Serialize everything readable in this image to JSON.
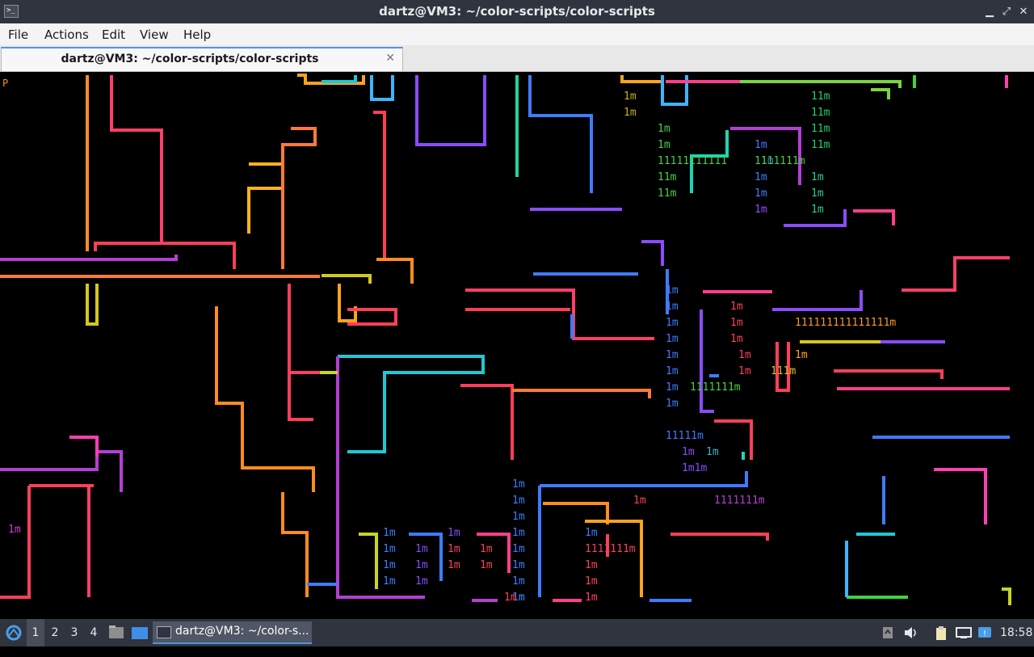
{
  "window": {
    "title": "dartz@VM3: ~/color-scripts/color-scripts",
    "minimize_glyph": "▁",
    "maximize_glyph": "⤢",
    "close_glyph": "✕"
  },
  "menu": {
    "file": "File",
    "actions": "Actions",
    "edit": "Edit",
    "view": "View",
    "help": "Help"
  },
  "tab": {
    "label": "dartz@VM3: ~/color-scripts/color-scripts",
    "close_glyph": "✕"
  },
  "terminal": {
    "prompt_fragment": "P",
    "glyph_groups": [
      {
        "text": "1m",
        "color": "#c8b400"
      },
      {
        "text": "1m",
        "color": "#c8b400"
      },
      {
        "text": "11m",
        "color": "#1fd06a"
      },
      {
        "text": "11m",
        "color": "#1fd06a"
      },
      {
        "text": "11m",
        "color": "#1fd06a"
      },
      {
        "text": "11m",
        "color": "#1fd06a"
      },
      {
        "text": "1m",
        "color": "#3fd43f"
      },
      {
        "text": "1m",
        "color": "#3fd43f"
      },
      {
        "text": "11111111111",
        "color": "#3fd43f"
      },
      {
        "text": "11m",
        "color": "#3fd43f"
      },
      {
        "text": "11m",
        "color": "#3fd43f"
      },
      {
        "text": "1m",
        "color": "#3f7bff"
      },
      {
        "text": "1111111m",
        "color": "#3fd43f"
      },
      {
        "text": "1m",
        "color": "#2ccf8a"
      },
      {
        "text": "1m",
        "color": "#2ccf8a"
      },
      {
        "text": "1m",
        "color": "#2ccf8a"
      },
      {
        "text": "1m",
        "color": "#3f7bff"
      },
      {
        "text": "1m",
        "color": "#3f7bff"
      },
      {
        "text": "1m",
        "color": "#3f7bff"
      },
      {
        "text": "1m",
        "color": "#8a4cff"
      },
      {
        "text": "1m",
        "color": "#3f7bff"
      },
      {
        "text": "1m",
        "color": "#3f7bff"
      },
      {
        "text": "1m",
        "color": "#3f7bff"
      },
      {
        "text": "1m",
        "color": "#3f7bff"
      },
      {
        "text": "1m",
        "color": "#3f7bff"
      },
      {
        "text": "1m",
        "color": "#3f7bff"
      },
      {
        "text": "1m",
        "color": "#3f7bff"
      },
      {
        "text": "1m",
        "color": "#3f7bff"
      },
      {
        "text": "11111m",
        "color": "#3f7bff"
      },
      {
        "text": "1m",
        "color": "#8a4cff"
      },
      {
        "text": "1m",
        "color": "#3fb4c8"
      },
      {
        "text": "1m1m",
        "color": "#8a4cff"
      },
      {
        "text": "1m",
        "color": "#ff3f5a"
      },
      {
        "text": "1m",
        "color": "#ff3f5a"
      },
      {
        "text": "1m",
        "color": "#ff3f5a"
      },
      {
        "text": "1m",
        "color": "#ff3f5a"
      },
      {
        "text": "1m",
        "color": "#ff3f5a"
      },
      {
        "text": "1111111m",
        "color": "#3fd43f"
      },
      {
        "text": "111111111111111m",
        "color": "#ff9a1f"
      },
      {
        "text": "1m",
        "color": "#ffa71f"
      },
      {
        "text": "111m",
        "color": "#d4c81f"
      },
      {
        "text": "1m",
        "color": "#3f7bff"
      },
      {
        "text": "1m",
        "color": "#3f7bff"
      },
      {
        "text": "1m",
        "color": "#3f7bff"
      },
      {
        "text": "1m",
        "color": "#3f7bff"
      },
      {
        "text": "1m",
        "color": "#3f7bff"
      },
      {
        "text": "1m",
        "color": "#3f7bff"
      },
      {
        "text": "1m",
        "color": "#3f7bff"
      },
      {
        "text": "1m",
        "color": "#3f7bff"
      },
      {
        "text": "1m",
        "color": "#3f7bff"
      },
      {
        "text": "1m",
        "color": "#3f7bff"
      },
      {
        "text": "1m",
        "color": "#8a4cff"
      },
      {
        "text": "1m",
        "color": "#8a4cff"
      },
      {
        "text": "1m",
        "color": "#8a4cff"
      },
      {
        "text": "1m",
        "color": "#8a4cff"
      },
      {
        "text": "1m",
        "color": "#ff3f5a"
      },
      {
        "text": "1m",
        "color": "#ff3f5a"
      },
      {
        "text": "1m",
        "color": "#ff3f5a"
      },
      {
        "text": "1m",
        "color": "#ff3f5a"
      },
      {
        "text": "1m",
        "color": "#3f7bff"
      },
      {
        "text": "1m",
        "color": "#3f7bff"
      },
      {
        "text": "1m",
        "color": "#3f7bff"
      },
      {
        "text": "1m",
        "color": "#3f7bff"
      },
      {
        "text": "1111111m",
        "color": "#ff3f5a"
      },
      {
        "text": "1m",
        "color": "#ff3f5a"
      },
      {
        "text": "1m",
        "color": "#ff3f5a"
      },
      {
        "text": "1m",
        "color": "#ff3f5a"
      },
      {
        "text": "1m",
        "color": "#ff3f5a"
      },
      {
        "text": "1m",
        "color": "#ff3f5a"
      },
      {
        "text": "1111111m",
        "color": "#b43fd4"
      },
      {
        "text": "1m",
        "color": "#c83fd4"
      }
    ]
  },
  "taskbar": {
    "workspaces": [
      "1",
      "2",
      "3",
      "4"
    ],
    "active_workspace": "1",
    "task_label": "dartz@VM3: ~/color-s...",
    "clock": "18:58"
  },
  "icons": {
    "start": "start-menu-icon",
    "file_manager": "file-manager-icon",
    "desktop": "show-desktop-icon",
    "terminal": "terminal-icon",
    "tray": [
      "notes-icon",
      "volume-icon",
      "clipboard-icon",
      "network-icon",
      "update-notifier-icon"
    ]
  }
}
